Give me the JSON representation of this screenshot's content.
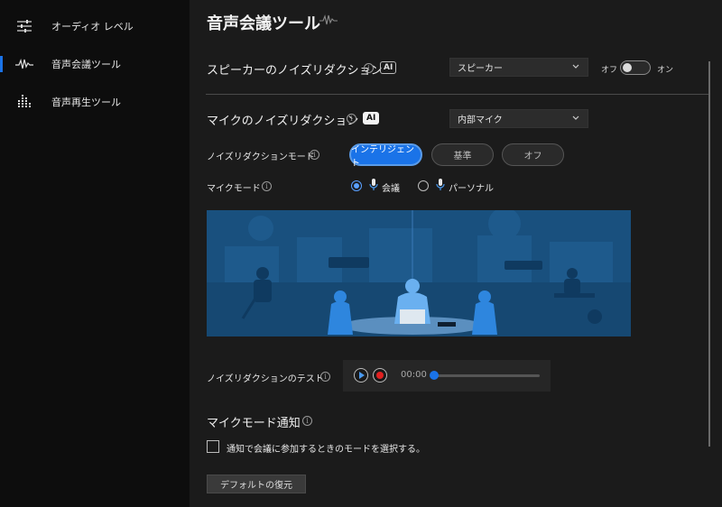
{
  "sidebar": {
    "items": [
      {
        "label": "オーディオ レベル",
        "icon": "sliders-icon",
        "active": false
      },
      {
        "label": "音声会議ツール",
        "icon": "waveform-icon",
        "active": true
      },
      {
        "label": "音声再生ツール",
        "icon": "equalizer-icon",
        "active": false
      }
    ]
  },
  "page": {
    "title": "音声会議ツール"
  },
  "speaker_nr": {
    "title": "スピーカーのノイズリダクション",
    "ai_badge": "AI",
    "device": "スピーカー",
    "toggle_off_label": "オフ",
    "toggle_on_label": "オン",
    "enabled": false
  },
  "mic_nr": {
    "title": "マイクのノイズリダクション",
    "ai_badge": "AI",
    "device": "内部マイク",
    "mode_label": "ノイズリダクションモード",
    "modes": [
      "インテリジェント",
      "基準",
      "オフ"
    ],
    "selected_mode": "インテリジェント",
    "mic_mode_label": "マイクモード",
    "mic_modes": [
      "会議",
      "パーソナル"
    ],
    "selected_mic_mode": "会議"
  },
  "test": {
    "label": "ノイズリダクションのテスト",
    "time": "00:00",
    "progress": 0
  },
  "notification": {
    "title": "マイクモード通知",
    "checkbox_label": "通知で会議に参加するときのモードを選択する。",
    "checked": false
  },
  "restore_button": "デフォルトの復元",
  "colors": {
    "accent": "#1a73e8",
    "sidebar_bg": "#0d0d0d",
    "main_bg": "#1b1b1b",
    "record": "#e02020"
  }
}
